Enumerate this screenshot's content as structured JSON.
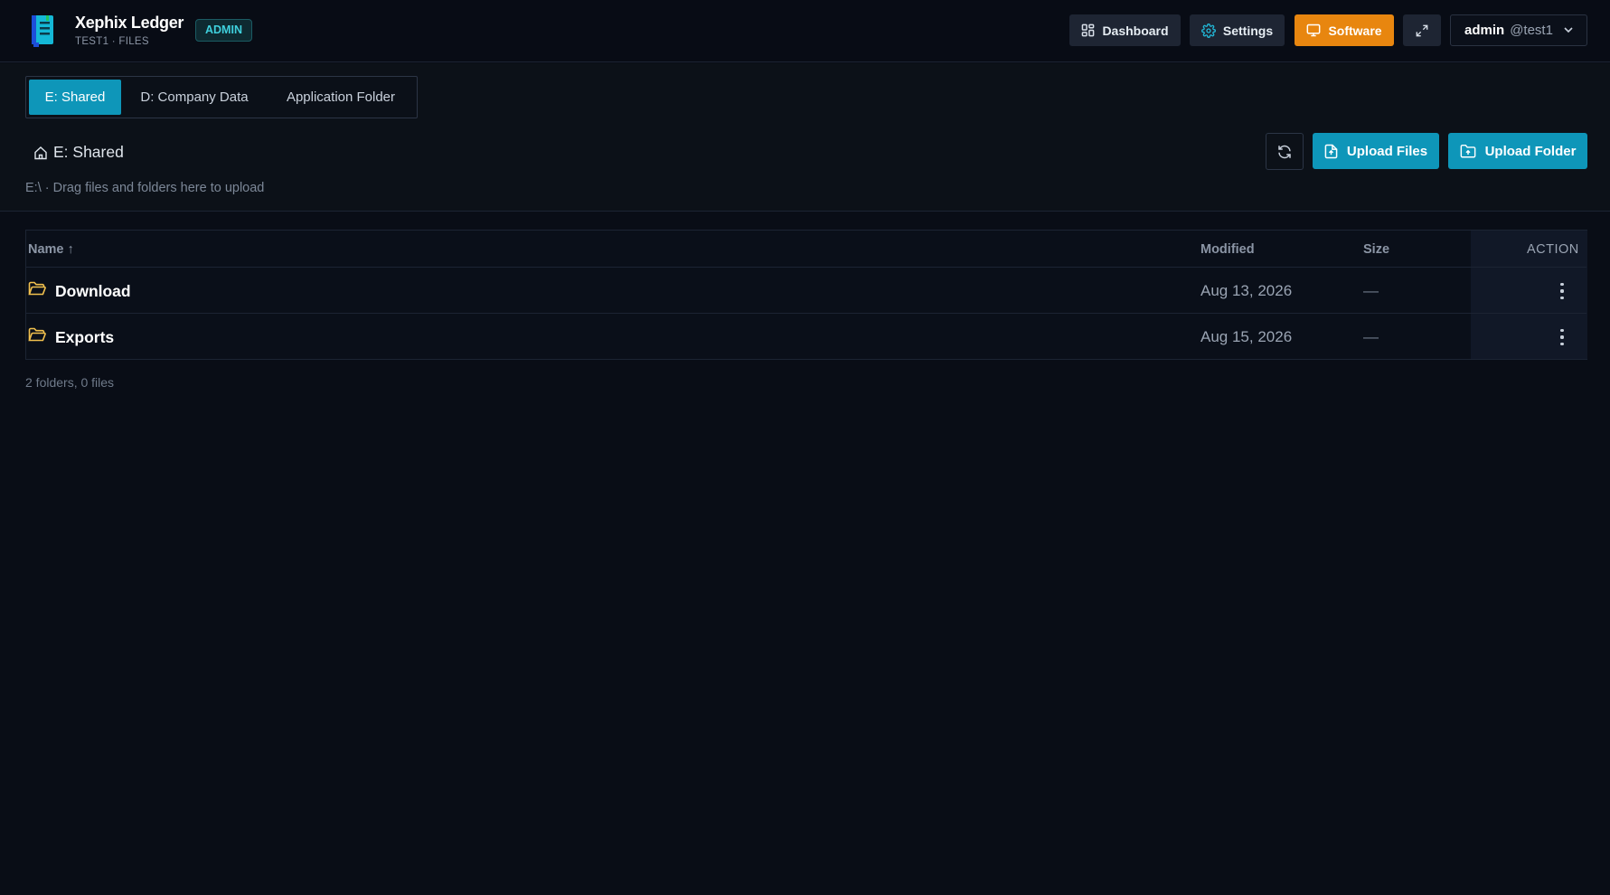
{
  "app": {
    "title": "Xephix Ledger",
    "subtitle": "TEST1 · FILES",
    "badge": "ADMIN",
    "logo_icon": "ledger-book-icon"
  },
  "header": {
    "dashboard_label": "Dashboard",
    "settings_label": "Settings",
    "software_label": "Software",
    "expand_icon": "expand-icon",
    "user": {
      "name": "admin",
      "handle": "@test1"
    }
  },
  "tabs": [
    {
      "label": "E: Shared",
      "active": true
    },
    {
      "label": "D: Company Data",
      "active": false
    },
    {
      "label": "Application Folder",
      "active": false
    }
  ],
  "breadcrumb": {
    "label": "E: Shared",
    "icon": "home-icon"
  },
  "hint": "E:\\ · Drag files and folders here to upload",
  "actions": {
    "upload_files_label": "Upload Files",
    "upload_folder_label": "Upload Folder",
    "refresh_icon": "refresh-icon"
  },
  "table": {
    "columns": {
      "name": "Name ↑",
      "modified": "Modified",
      "size": "Size",
      "action": "ACTION"
    },
    "rows": [
      {
        "name": "Download",
        "modified": "Aug 13, 2026",
        "size": "—",
        "type": "folder"
      },
      {
        "name": "Exports",
        "modified": "Aug 15, 2026",
        "size": "—",
        "type": "folder"
      }
    ]
  },
  "summary": "2 folders, 0 files",
  "colors": {
    "background": "#090d16",
    "accent": "#0e96b9",
    "software_button": "#e8860f",
    "folder_icon": "#f2c14e",
    "badge_text": "#3fd0dd"
  }
}
